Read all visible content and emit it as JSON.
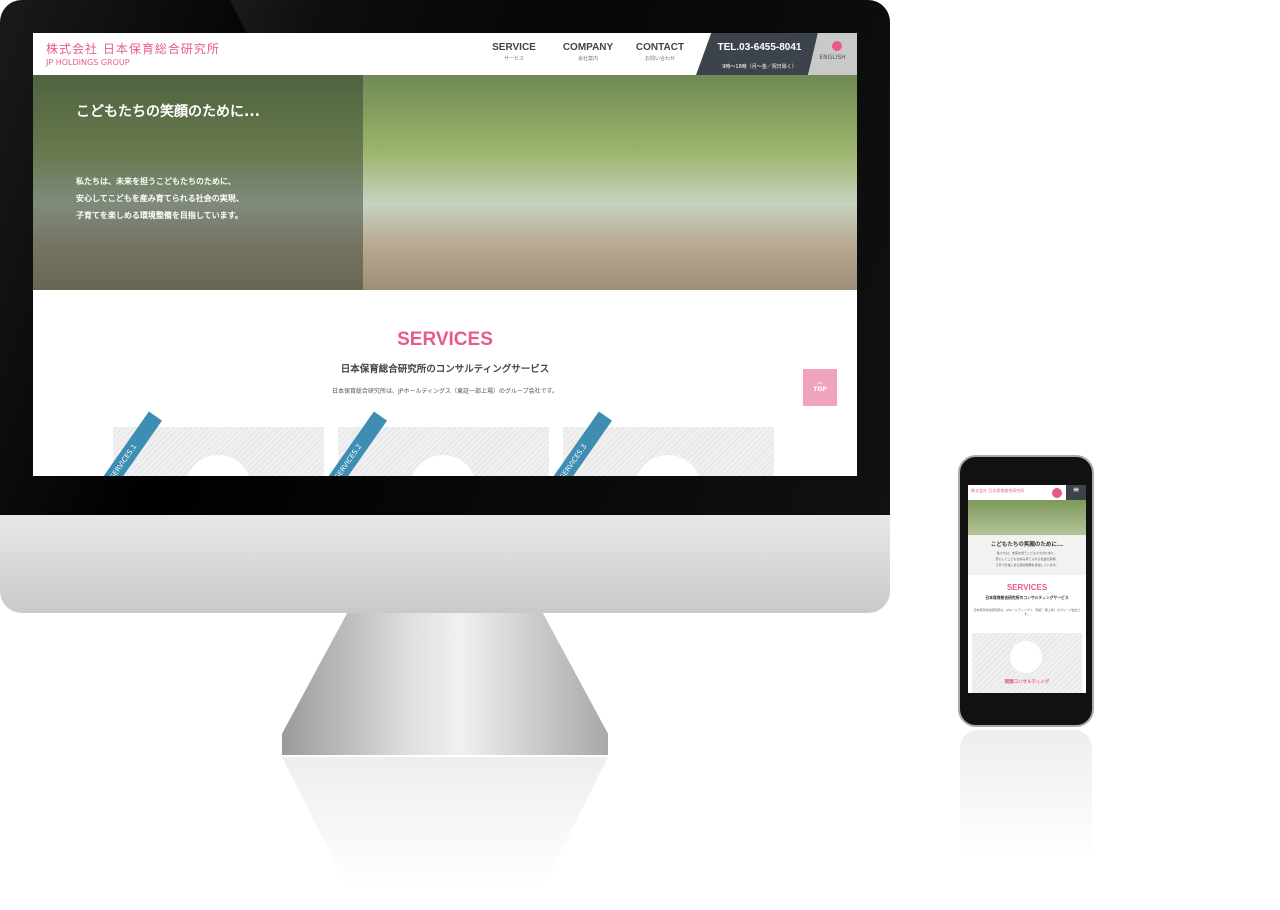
{
  "site": {
    "logo_ja": "株式会社 日本保育総合研究所",
    "logo_en": "JP HOLDINGS GROUP",
    "nav": [
      {
        "label": "SERVICE",
        "sub": "サービス"
      },
      {
        "label": "COMPANY",
        "sub": "会社案内"
      },
      {
        "label": "CONTACT",
        "sub": "お問い合わせ"
      }
    ],
    "tel": "TEL.03-6455-8041",
    "tel_hours": "9時〜18時（月〜金／祝日除く）",
    "english": "ENGLISH",
    "hero": {
      "title": "こどもたちの笑顔のために...",
      "lines": [
        "私たちは、未来を担うこどもたちのために、",
        "安心してこどもを産み育てられる社会の実現、",
        "子育てを楽しめる環境整備を目指しています。"
      ]
    },
    "services": {
      "title": "SERVICES",
      "subtitle": "日本保育総合研究所のコンサルティングサービス",
      "desc": "日本保育総合研究所は、JPホールディングス（東証一部上場）のグループ会社です。",
      "cards": [
        "SERVICES.1",
        "SERVICES.2",
        "SERVICES.3"
      ]
    },
    "top_label": "TOP",
    "mobile_card_title": "開園コンサルティング"
  },
  "colors": {
    "accent": "#e85a8c",
    "ribbon": "#3e8db3",
    "tel_bg": "#3d434b"
  }
}
